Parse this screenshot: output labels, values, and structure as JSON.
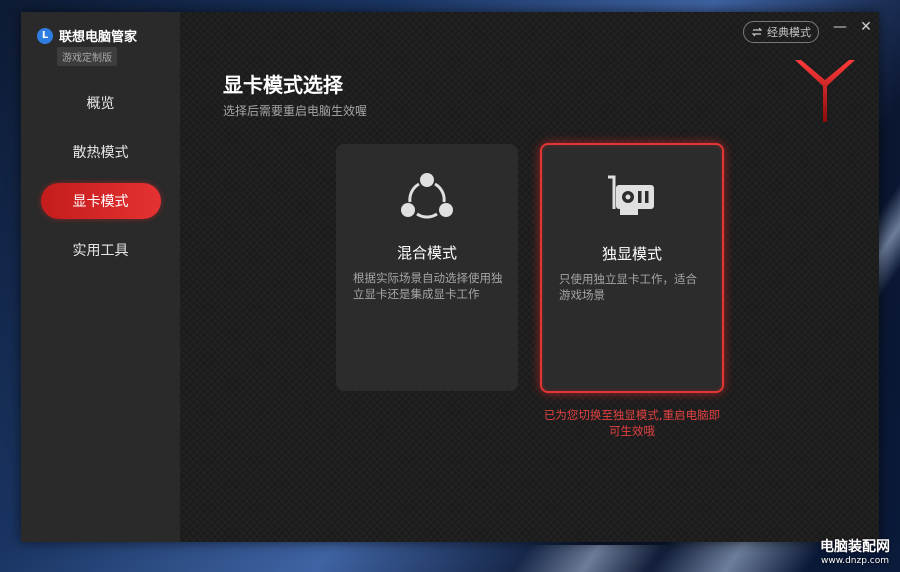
{
  "app": {
    "logo_letter": "L",
    "name": "联想电脑管家",
    "edition": "游戏定制版"
  },
  "sidebar": {
    "items": [
      {
        "label": "概览",
        "active": false
      },
      {
        "label": "散热模式",
        "active": false
      },
      {
        "label": "显卡模式",
        "active": true
      },
      {
        "label": "实用工具",
        "active": false
      }
    ]
  },
  "titlebar": {
    "classic_mode_label": "经典模式",
    "minimize_glyph": "—",
    "close_glyph": "✕"
  },
  "main": {
    "title": "显卡模式选择",
    "subtitle": "选择后需要重启电脑生效喔",
    "cards": [
      {
        "name": "混合模式",
        "desc": "根据实际场景自动选择使用独立显卡还是集成显卡工作",
        "icon": "share-nodes-icon",
        "selected": false
      },
      {
        "name": "独显模式",
        "desc": "只使用独立显卡工作，适合游戏场景",
        "icon": "graphics-card-icon",
        "selected": true
      }
    ],
    "notice": "已为您切换至独显模式,重启电脑即可生效哦"
  },
  "watermark": {
    "cn": "电脑装配网",
    "url": "www.dnzp.com"
  },
  "colors": {
    "accent": "#e23535",
    "sidebar_bg": "#2a2a2a",
    "main_bg": "#1b1b1b",
    "card_bg": "#2c2c2c",
    "logo_blue": "#2f7de1"
  }
}
